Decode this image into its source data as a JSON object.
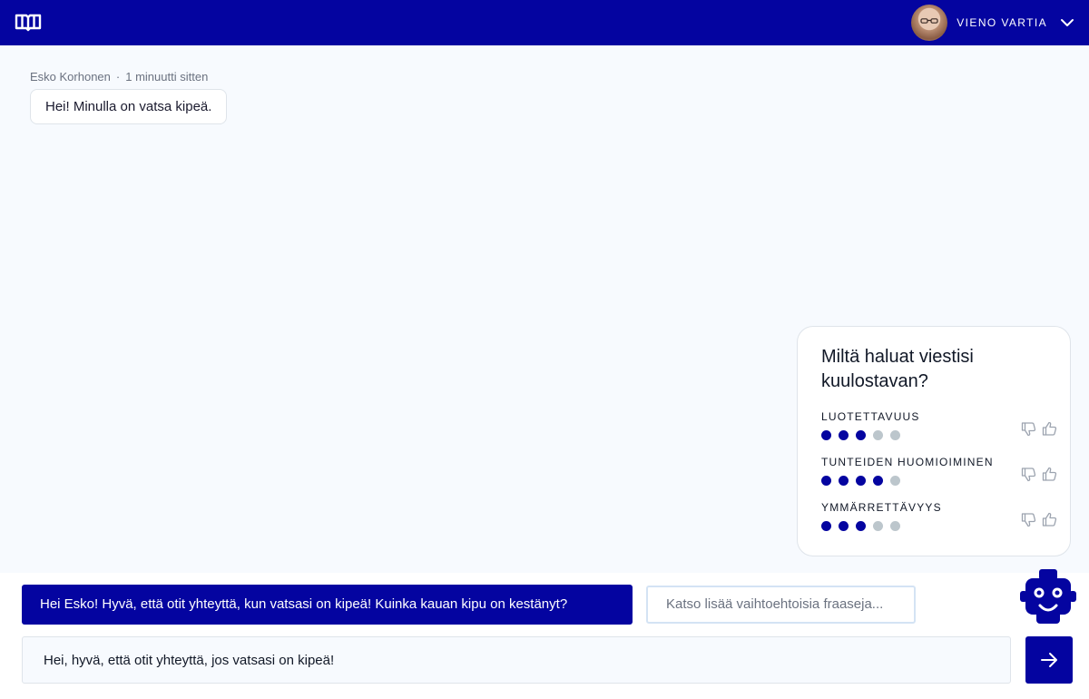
{
  "header": {
    "logo_icon": "book-icon",
    "user_name": "VIENO VARTIA",
    "menu_icon": "chevron-down-icon"
  },
  "conversation": {
    "author": "Esko Korhonen",
    "separator": "·",
    "time": "1 minuutti sitten",
    "message": "Hei! Minulla on vatsa kipeä."
  },
  "tone_card": {
    "title": "Miltä haluat viestisi kuulostavan?",
    "metrics": [
      {
        "label": "LUOTETTAVUUS",
        "score": 3,
        "max": 5
      },
      {
        "label": "TUNTEIDEN HUOMIOIMINEN",
        "score": 4,
        "max": 5
      },
      {
        "label": "YMMÄRRETTÄVYYS",
        "score": 3,
        "max": 5
      }
    ]
  },
  "composer": {
    "suggestion": "Hei Esko! Hyvä, että otit yhteyttä, kun vatsasi on kipeä! Kuinka kauan kipu on kestänyt?",
    "more_label": "Katso lisää vaihtoehtoisia fraaseja...",
    "input_value": "Hei, hyvä, että otit yhteyttä, jos vatsasi on kipeä!",
    "send_icon": "arrow-right-icon",
    "assistant_icon": "robot-icon"
  },
  "colors": {
    "brand": "#0404a0",
    "dot_inactive": "#bcc6cc",
    "background": "#f7fafe"
  }
}
